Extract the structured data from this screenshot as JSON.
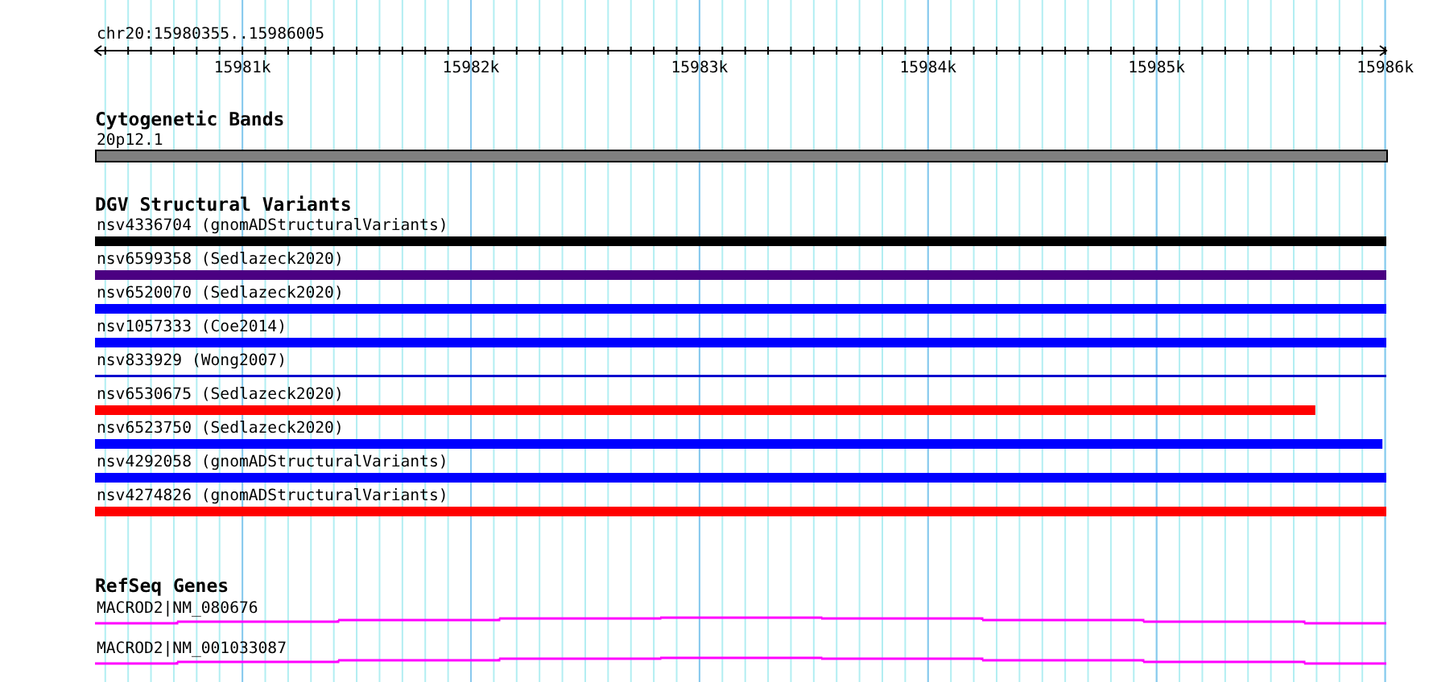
{
  "ruler": {
    "location": "chr20:15980355..15986005",
    "ticks": [
      "15981k",
      "15982k",
      "15983k",
      "15984k",
      "15985k",
      "15986k"
    ]
  },
  "cytoband": {
    "title": "Cytogenetic Bands",
    "features": [
      {
        "label": "20p12.1"
      }
    ]
  },
  "dgv": {
    "title": "DGV Structural Variants",
    "features": [
      {
        "label": "nsv4336704 (gnomADStructuralVariants)",
        "kind": "bar",
        "color": "#000000",
        "level": 1
      },
      {
        "label": "nsv6599358 (Sedlazeck2020)",
        "kind": "bar",
        "color": "#4b0082",
        "level": 1
      },
      {
        "label": "nsv6520070 (Sedlazeck2020)",
        "kind": "bar",
        "color": "#0000ff",
        "level": 1
      },
      {
        "label": "nsv1057333 (Coe2014)",
        "kind": "bar",
        "color": "#0000ff",
        "level": 1
      },
      {
        "label": "nsv833929 (Wong2007)",
        "kind": "line",
        "color": "#0000cd",
        "level": 1
      },
      {
        "label": "nsv6530675 (Sedlazeck2020)",
        "kind": "bar",
        "color": "#ff0000",
        "level": 0.945
      },
      {
        "label": "nsv6523750 (Sedlazeck2020)",
        "kind": "bar",
        "color": "#0000ff",
        "level": 0.997
      },
      {
        "label": "nsv4292058 (gnomADStructuralVariants)",
        "kind": "bar",
        "color": "#0000ff",
        "level": 1
      },
      {
        "label": "nsv4274826 (gnomADStructuralVariants)",
        "kind": "bar",
        "color": "#ff0000",
        "level": 1
      }
    ]
  },
  "genes": {
    "title": "RefSeq Genes",
    "features": [
      {
        "label": "MACROD2|NM_080676"
      },
      {
        "label": "MACROD2|NM_001033087"
      }
    ]
  }
}
